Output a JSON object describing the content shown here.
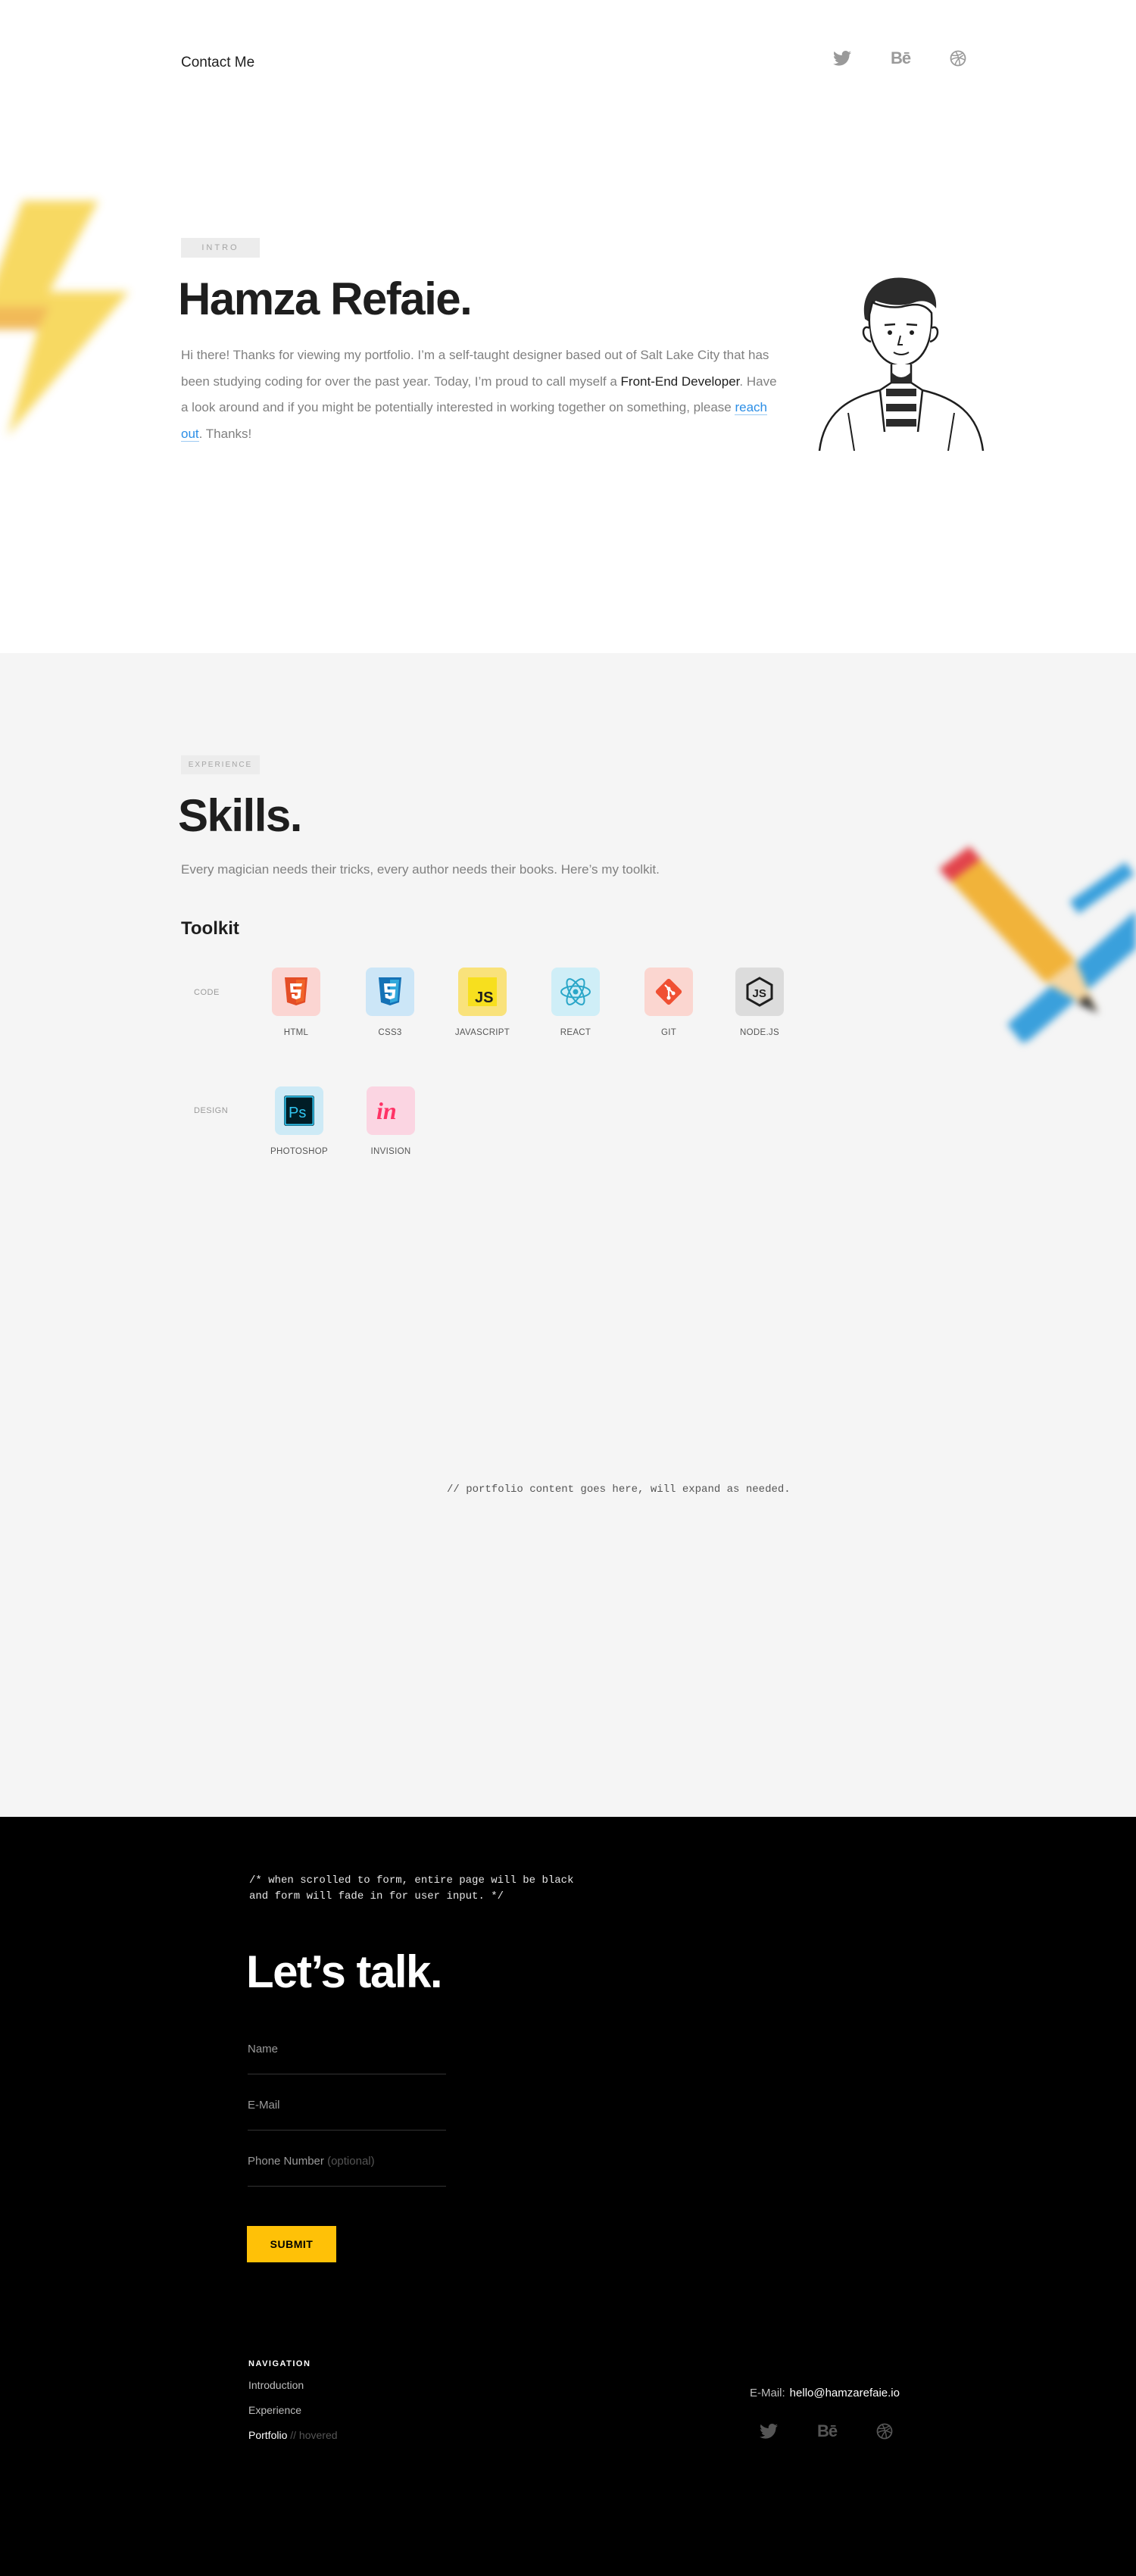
{
  "header": {
    "contact_label": "Contact Me",
    "social": [
      "twitter-icon",
      "behance-icon",
      "dribbble-icon"
    ],
    "behance_glyph": "Bē"
  },
  "intro": {
    "tag": "INTRO",
    "title": "Hamza Refaie.",
    "text_1": "Hi there! Thanks for viewing my portfolio. I’m a self-taught designer based out of Salt Lake City that has been studying coding for over the past year. Today, I’m proud to call myself a ",
    "highlight": "Front-End Developer",
    "text_2": ". Have a look around and if you might be potentially interested in working together on something, please ",
    "link": "reach out",
    "text_3": ". Thanks!"
  },
  "skills": {
    "tag": "EXPERIENCE",
    "title": "Skills.",
    "subtitle": "Every magician needs their tricks, every author needs their books. Here’s my toolkit.",
    "toolkit_title": "Toolkit",
    "code_label": "CODE",
    "design_label": "DESIGN",
    "code_tools": [
      "HTML",
      "CSS3",
      "JAVASCRIPT",
      "REACT",
      "GIT",
      "NODE.JS"
    ],
    "design_tools": [
      "PHOTOSHOP",
      "INVISION"
    ],
    "portfolio_note": "//  portfolio content goes here, will expand as needed."
  },
  "contact": {
    "note_line1": "/*  when scrolled to form, entire page will be black",
    "note_line2": "and form will fade in for user input. */",
    "title": "Let’s talk.",
    "name_label": "Name",
    "email_label": "E-Mail",
    "phone_label": "Phone Number",
    "phone_optional": "(optional)",
    "submit_label": "SUBMIT"
  },
  "footer": {
    "nav_title": "NAVIGATION",
    "nav_items": [
      "Introduction",
      "Experience",
      "Portfolio"
    ],
    "hover_note": "// hovered",
    "email_label": "E-Mail:",
    "email": "hello@hamzarefaie.io"
  },
  "colors": {
    "accent_yellow": "#ffc107",
    "link_blue": "#2b8ee6",
    "skills_bg": "#f5f5f5",
    "contact_bg": "#000000"
  }
}
